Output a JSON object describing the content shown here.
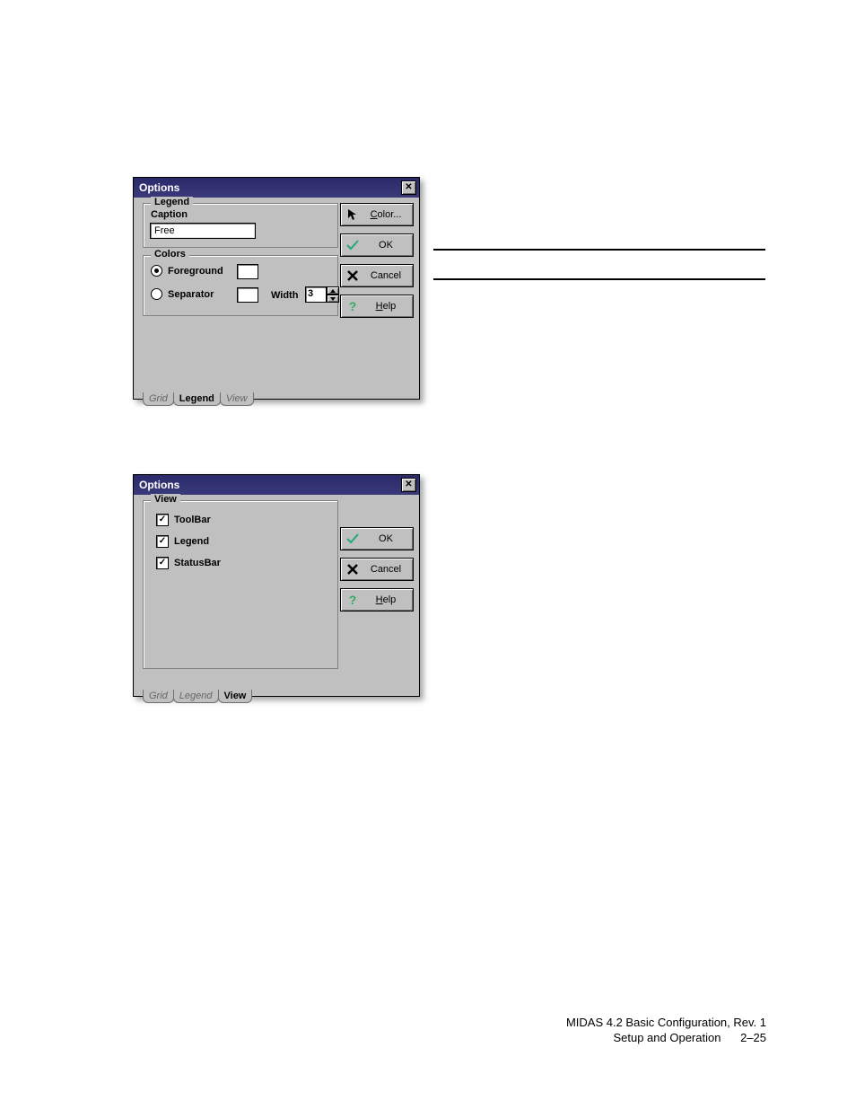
{
  "dialog1": {
    "title": "Options",
    "legend": {
      "group_label": "Legend",
      "caption_label": "Caption",
      "caption_value": "Free"
    },
    "colors": {
      "group_label": "Colors",
      "foreground_label": "Foreground",
      "separator_label": "Separator",
      "width_label": "Width",
      "width_value": "3"
    },
    "buttons": {
      "color": "Color...",
      "ok": "OK",
      "cancel": "Cancel",
      "help": "Help"
    },
    "tabs": {
      "grid": "Grid",
      "legend": "Legend",
      "view": "View"
    }
  },
  "dialog2": {
    "title": "Options",
    "view": {
      "group_label": "View",
      "toolbar_label": "ToolBar",
      "legend_label": "Legend",
      "statusbar_label": "StatusBar"
    },
    "buttons": {
      "ok": "OK",
      "cancel": "Cancel",
      "help": "Help"
    },
    "tabs": {
      "grid": "Grid",
      "legend": "Legend",
      "view": "View"
    }
  },
  "footer": {
    "line1": "MIDAS 4.2 Basic Configuration, Rev. 1",
    "line2_label": "Setup and Operation",
    "line2_page": "2–25"
  }
}
